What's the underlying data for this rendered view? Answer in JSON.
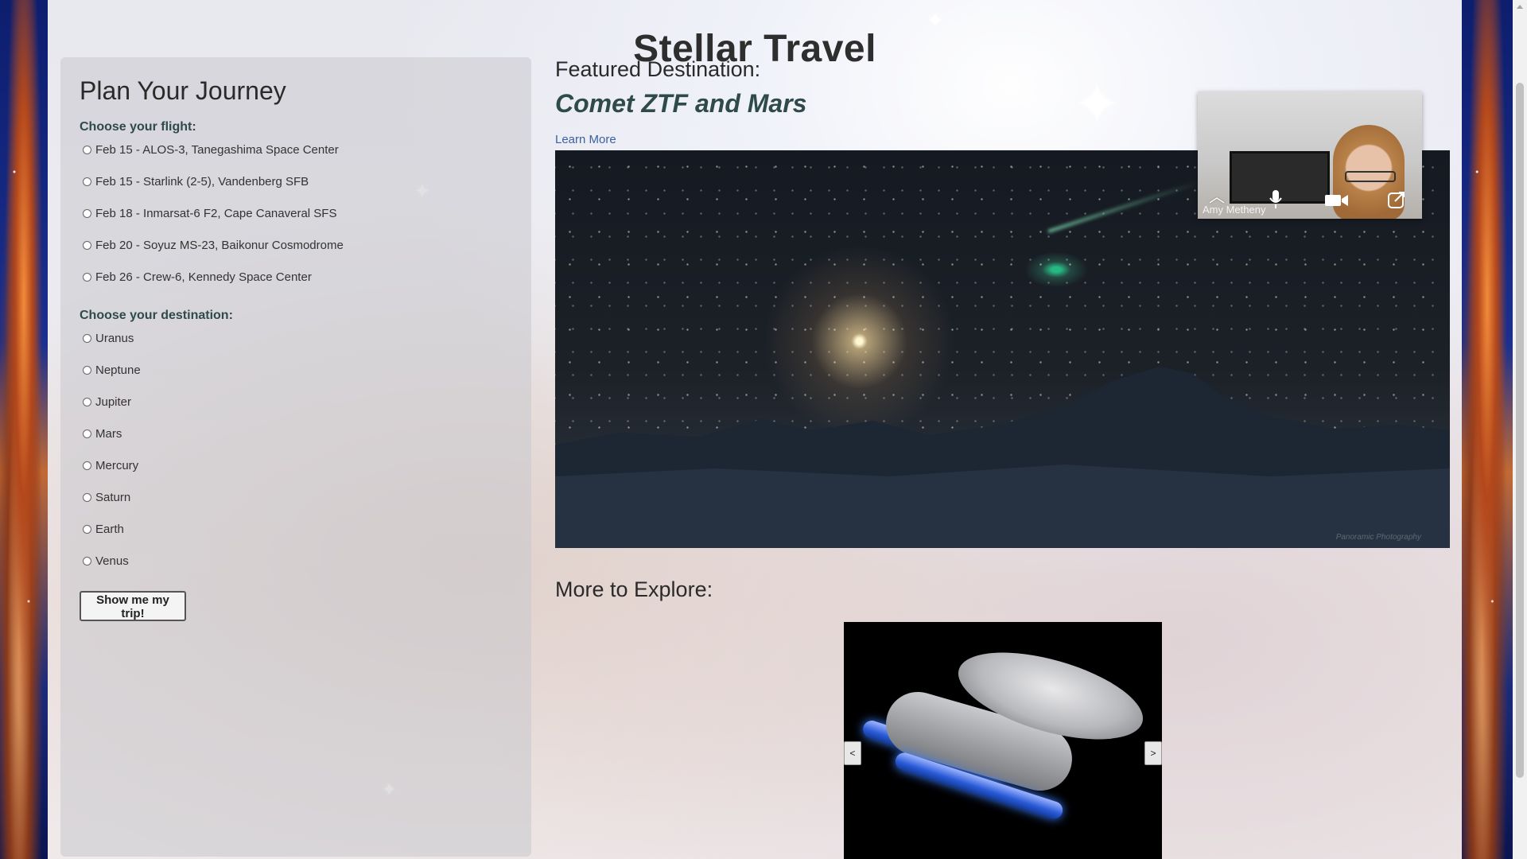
{
  "site": {
    "title": "Stellar Travel"
  },
  "planner": {
    "heading": "Plan Your Journey",
    "flight_label": "Choose your flight:",
    "flights": [
      "Feb 15 - ALOS-3, Tanegashima Space Center",
      "Feb 15 - Starlink (2-5), Vandenberg SFB",
      "Feb 18 - Inmarsat-6 F2, Cape Canaveral SFS",
      "Feb 20 - Soyuz MS-23, Baikonur Cosmodrome",
      "Feb 26 - Crew-6, Kennedy Space Center"
    ],
    "destination_label": "Choose your destination:",
    "destinations": [
      "Uranus",
      "Neptune",
      "Jupiter",
      "Mars",
      "Mercury",
      "Saturn",
      "Earth",
      "Venus"
    ],
    "submit_label": "Show me my trip!"
  },
  "featured": {
    "heading": "Featured Destination:",
    "name": "Comet ZTF and Mars",
    "link_label": "Learn More",
    "image_credit": "Panoramic Photography"
  },
  "explore": {
    "heading": "More to Explore:",
    "prev_label": "<",
    "next_label": ">"
  },
  "video_call": {
    "participant_name": "Amy Metheny",
    "controls": [
      "chevron-up-icon",
      "microphone-icon",
      "video-camera-icon",
      "share-screen-icon"
    ]
  },
  "colors": {
    "title": "#2e2e2e",
    "accent_teal": "#2f4a4a",
    "link": "#3b5f9f"
  }
}
